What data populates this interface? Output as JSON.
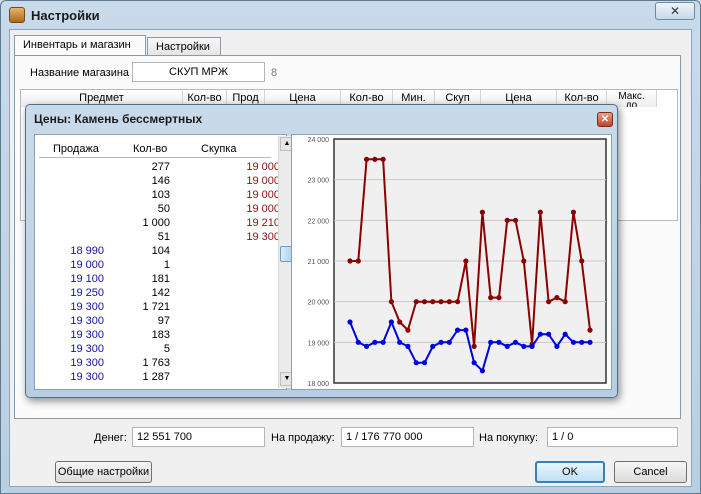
{
  "window": {
    "title": "Настройки",
    "close_glyph": "✕"
  },
  "tabs": [
    "Инвентарь и магазин",
    "Настройки"
  ],
  "shop": {
    "name_label": "Название магазина",
    "name_value": "СКУП МРЖ",
    "name_counter": "8"
  },
  "table": {
    "headers": [
      "Предмет",
      "Кол-во",
      "Прод",
      "Цена",
      "Кол-во",
      "Мин.",
      "Скуп",
      "Цена",
      "Кол-во",
      "Макс.\nдо"
    ]
  },
  "popup": {
    "title": "Цены:  Камень бессмертных",
    "close_glyph": "✕",
    "columns": [
      "Продажа",
      "Кол-во",
      "Скупка"
    ],
    "rows": [
      [
        "",
        "277",
        "19 000"
      ],
      [
        "",
        "146",
        "19 000"
      ],
      [
        "",
        "103",
        "19 000"
      ],
      [
        "",
        "50",
        "19 000"
      ],
      [
        "",
        "1 000",
        "19 210"
      ],
      [
        "",
        "51",
        "19 300"
      ],
      [
        "18 990",
        "104",
        ""
      ],
      [
        "19 000",
        "1",
        ""
      ],
      [
        "19 100",
        "181",
        ""
      ],
      [
        "19 250",
        "142",
        ""
      ],
      [
        "19 300",
        "1 721",
        ""
      ],
      [
        "19 300",
        "97",
        ""
      ],
      [
        "19 300",
        "183",
        ""
      ],
      [
        "19 300",
        "5",
        ""
      ],
      [
        "19 300",
        "1 763",
        ""
      ],
      [
        "19 300",
        "1 287",
        ""
      ]
    ]
  },
  "chart_data": {
    "type": "line",
    "ylim": [
      18000,
      24000
    ],
    "y_ticks": [
      "24 000",
      "23 000",
      "22 000",
      "21 000",
      "20 000",
      "19 000",
      "18 000"
    ],
    "grid": true,
    "colors": {
      "buy": "#8b0000",
      "sell": "#0000e0"
    },
    "series": [
      {
        "key": "buy",
        "values": [
          21000,
          21000,
          23500,
          23500,
          23500,
          20000,
          19500,
          19300,
          20000,
          20000,
          20000,
          20000,
          20000,
          20000,
          21000,
          18900,
          22200,
          20100,
          20100,
          22000,
          22000,
          21000,
          18950,
          22200,
          20000,
          20100,
          20000,
          22200,
          21000,
          19300
        ]
      },
      {
        "key": "sell",
        "values": [
          19500,
          19000,
          18900,
          19000,
          19000,
          19500,
          19000,
          18900,
          18500,
          18500,
          18900,
          19000,
          19000,
          19300,
          19300,
          18500,
          18300,
          19000,
          19000,
          18900,
          19000,
          18900,
          18900,
          19200,
          19200,
          18900,
          19200,
          19000,
          19000,
          19000
        ]
      }
    ]
  },
  "footer": {
    "money_label": "Денег:",
    "money_value": "12 551 700",
    "sale_label": "На продажу:",
    "sale_value": "1 / 176 770 000",
    "buy_label": "На покупку:",
    "buy_value": "1 / 0",
    "general_settings": "Общие настройки",
    "ok": "OK",
    "cancel": "Cancel"
  }
}
